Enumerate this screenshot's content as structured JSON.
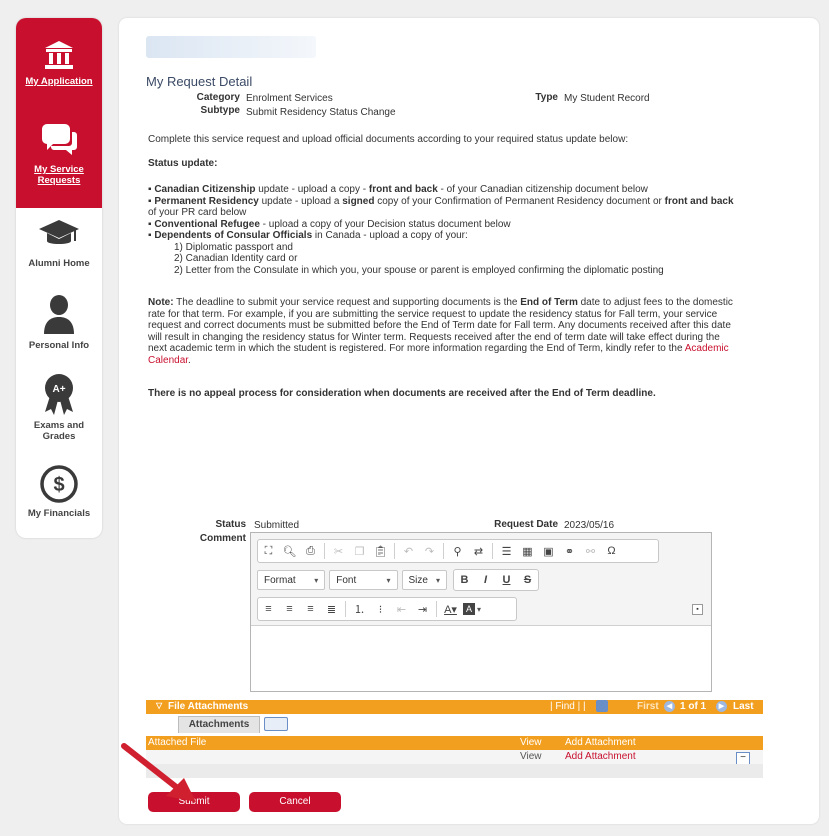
{
  "sidebar": {
    "items": [
      {
        "label": "My Application",
        "icon": "institution-icon",
        "active": true
      },
      {
        "label": "My Service Requests",
        "icon": "chat-icon",
        "active": true
      },
      {
        "label": "Alumni Home",
        "icon": "graduation-cap-icon",
        "active": false
      },
      {
        "label": "Personal Info",
        "icon": "person-icon",
        "active": false
      },
      {
        "label": "Exams and Grades",
        "icon": "award-ribbon-icon",
        "active": false
      },
      {
        "label": "My Financials",
        "icon": "dollar-icon",
        "active": false
      }
    ]
  },
  "detail": {
    "title": "My Request Detail",
    "category_label": "Category",
    "category_value": "Enrolment Services",
    "type_label": "Type",
    "type_value": "My Student Record",
    "subtype_label": "Subtype",
    "subtype_value": "Submit Residency Status Change"
  },
  "instructions": {
    "intro": "Complete this service request and upload official documents according to your required status update below:",
    "status_heading": "Status update:",
    "b1_bold": "Canadian Citizenship",
    "b1_a": " update - upload a copy - ",
    "b1_bold2": "front and back",
    "b1_b": " - of your Canadian citizenship document below",
    "b2_bold": "Permanent Residency",
    "b2_a": " update - upload a ",
    "b2_bold2": "signed",
    "b2_b": " copy of your Confirmation of Permanent Residency document or ",
    "b2_bold3": "front and back",
    "b2_c": " of your PR card below",
    "b3_bold": "Conventional Refugee",
    "b3_a": " - upload a copy of your Decision status document below",
    "b4_bold": "Dependents of Consular Officials",
    "b4_a": " in Canada - upload a copy of your:",
    "sub1": "1) Diplomatic passport and",
    "sub2": "2) Canadian Identity card or",
    "sub3": "2) Letter from the Consulate in which you, your spouse or parent is employed confirming the diplomatic posting",
    "note_bold": "Note:",
    "note_a": " The deadline to submit your service request and supporting documents is the ",
    "note_bold2": "End of Term",
    "note_b": " date to adjust fees to the domestic rate for that term. For example, if you are submitting the service request to update the residency status for Fall term, your service request and correct documents must be submitted before the End of Term date for Fall term. Any documents received after this date will result in changing the residency status for Winter term. Requests received after the end of term date will take effect during the next academic term in which the student is registered. For more information regarding the End of Term, kindly refer to the ",
    "note_link": "Academic Calendar",
    "note_end": ".",
    "no_appeal": "There is no appeal process for consideration when documents are received after the End of Term deadline."
  },
  "form": {
    "status_label": "Status",
    "status_value": "Submitted",
    "request_date_label": "Request Date",
    "request_date_value": "2023/05/16",
    "comment_label": "Comment",
    "format_label": "Format",
    "font_label": "Font",
    "size_label": "Size",
    "bold_glyph": "B",
    "italic_glyph": "I",
    "underline_glyph": "U",
    "strike_glyph": "S"
  },
  "attachments": {
    "bar_title": "File Attachments",
    "find_label": "| Find | |",
    "first_label": "First",
    "page_label": "1 of 1",
    "last_label": "Last",
    "tab_label": "Attachments",
    "col_file": "Attached File",
    "col_view": "View",
    "col_add": "Add Attachment",
    "row_view": "View",
    "row_add": "Add Attachment"
  },
  "buttons": {
    "submit": "Submit",
    "cancel": "Cancel"
  },
  "colors": {
    "brand_red": "#c8102e",
    "orange": "#f29e1e"
  }
}
